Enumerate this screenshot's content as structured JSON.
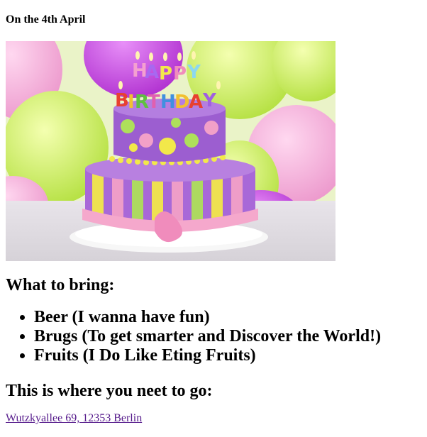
{
  "date_heading": "On the 4th April",
  "image": {
    "alt": "Happy Birthday cake with candles and balloons",
    "candle_text": "HAPPY BIRTHDAY",
    "colors": {
      "bg_green": "#c8ee5a",
      "bg_pink": "#f5a8d8",
      "bg_purple": "#c04ad8",
      "cake_purple": "#a066d6",
      "cake_pink": "#f2a0c8",
      "cake_yellow": "#f2e84a",
      "cake_green": "#aee05a",
      "plate": "#f0f0f0"
    }
  },
  "bring": {
    "heading": "What to bring:",
    "items": [
      "Beer (I wanna have fun)",
      "Brugs (To get smarter and Discover the World!)",
      "Fruits (I Do Like Eting Fruits)"
    ]
  },
  "go": {
    "heading": "This is where you neet to go:",
    "address": "Wutzkyallee 69, 12353 Berlin"
  }
}
